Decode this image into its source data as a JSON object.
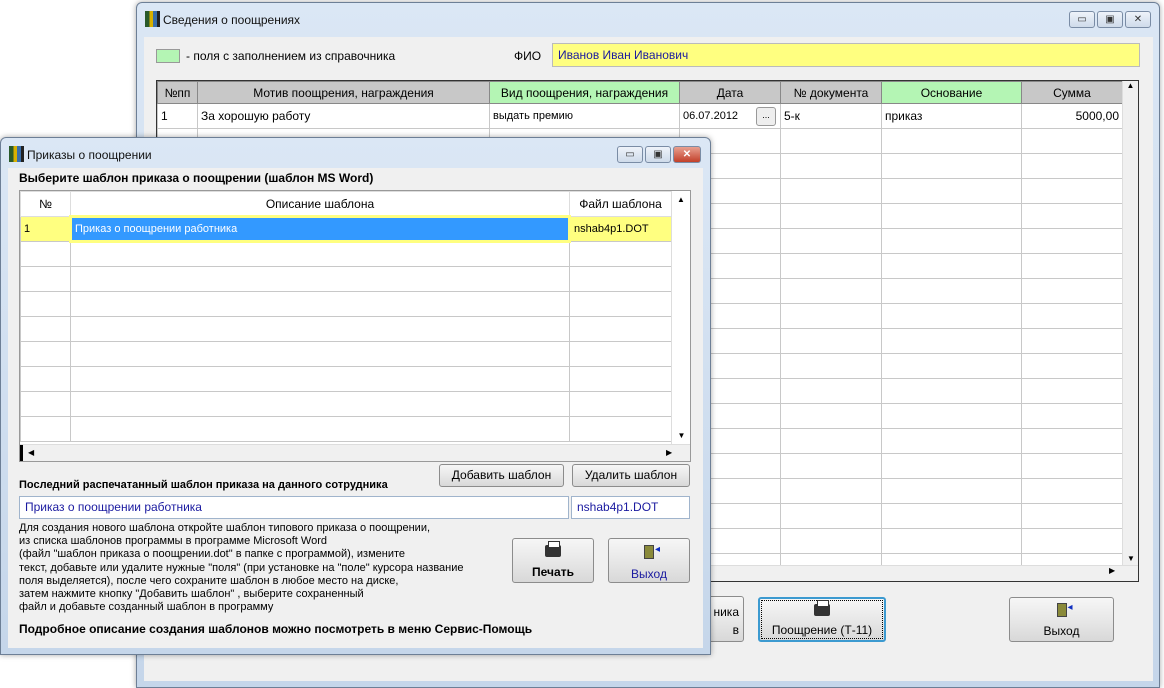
{
  "main": {
    "title": "Сведения о поощрениях",
    "legend": "- поля с заполнением из справочника",
    "fio_label": "ФИО",
    "fio_value": "Иванов Иван Иванович",
    "columns": [
      "№пп",
      "Мотив поощрения, награждения",
      "Вид поощрения, награждения",
      "Дата",
      "№ документа",
      "Основание",
      "Сумма"
    ],
    "rows": [
      [
        "1",
        "За хорошую работу",
        "выдать премию",
        "06.07.2012",
        "5-к",
        "приказ",
        "5000,00"
      ]
    ],
    "partial_button_line1": "ника",
    "partial_button_line2": "в",
    "reward_button": "Поощрение (Т-11)",
    "exit_button": "Выход"
  },
  "dialog": {
    "title": "Приказы о поощрении",
    "prompt": "Выберите шаблон приказа о поощрении (шаблон MS Word)",
    "columns": [
      "№",
      "Описание шаблона",
      "Файл шаблона"
    ],
    "rows": [
      [
        "1",
        "Приказ о поощрении работника",
        "nshab4p1.DOT"
      ]
    ],
    "add_button": "Добавить шаблон",
    "delete_button": "Удалить шаблон",
    "last_label": "Последний распечатанный шаблон приказа на  данного сотрудника",
    "last_template": "Приказ о поощрении работника",
    "last_file": "nshab4p1.DOT",
    "help_lines": [
      "Для создания нового шаблона откройте шаблон типового приказа о поощрении,",
      "из списка шаблонов программы в программе Microsoft Word",
      "(файл \"шаблон приказа о поощрении.dot\" в папке  с программой),  измените",
      "текст, добавьте или удалите нужные \"поля\" (при установке на \"поле\" курсора название",
      "поля выделяется), после чего сохраните шаблон в любое место на диске,",
      "затем нажмите кнопку \"Добавить шаблон\" , выберите сохраненный",
      "файл и добавьте созданный шаблон в программу"
    ],
    "help_footer": "Подробное описание создания шаблонов можно посмотреть в меню Сервис-Помощь",
    "print_button": "Печать",
    "exit_button": "Выход"
  },
  "colors": {
    "green": "#b4f5b4",
    "yellow": "#ffff80",
    "selection": "#3399ff"
  }
}
